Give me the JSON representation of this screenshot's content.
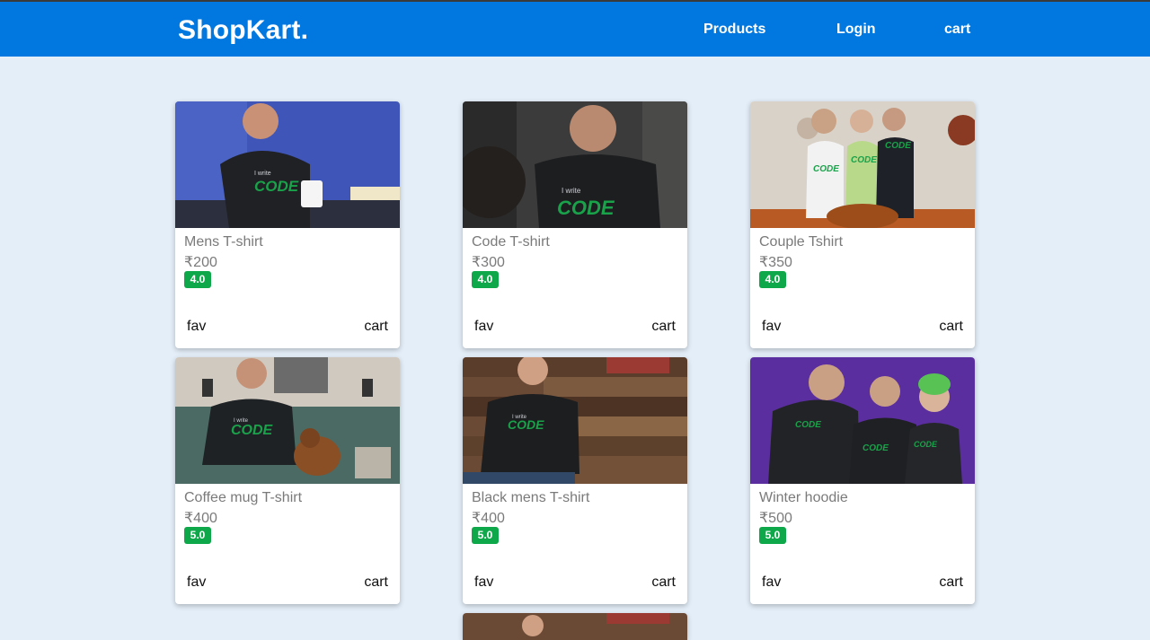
{
  "navbar": {
    "brand": "ShopKart.",
    "links": [
      {
        "label": "Products"
      },
      {
        "label": "Login"
      },
      {
        "label": "cart"
      }
    ],
    "color": "#0078e0"
  },
  "products": [
    {
      "title": "Mens T-shirt",
      "price": "₹200",
      "rating": "4.0",
      "fav_label": "fav",
      "cart_label": "cart"
    },
    {
      "title": "Code T-shirt",
      "price": "₹300",
      "rating": "4.0",
      "fav_label": "fav",
      "cart_label": "cart"
    },
    {
      "title": "Couple Tshirt",
      "price": "₹350",
      "rating": "4.0",
      "fav_label": "fav",
      "cart_label": "cart"
    },
    {
      "title": "Coffee mug T-shirt",
      "price": "₹400",
      "rating": "5.0",
      "fav_label": "fav",
      "cart_label": "cart"
    },
    {
      "title": "Black mens T-shirt",
      "price": "₹400",
      "rating": "5.0",
      "fav_label": "fav",
      "cart_label": "cart"
    },
    {
      "title": "Winter hoodie",
      "price": "₹500",
      "rating": "5.0",
      "fav_label": "fav",
      "cart_label": "cart"
    }
  ],
  "colors": {
    "rating_badge": "#0ea84a",
    "page_background": "#e4eef8"
  }
}
